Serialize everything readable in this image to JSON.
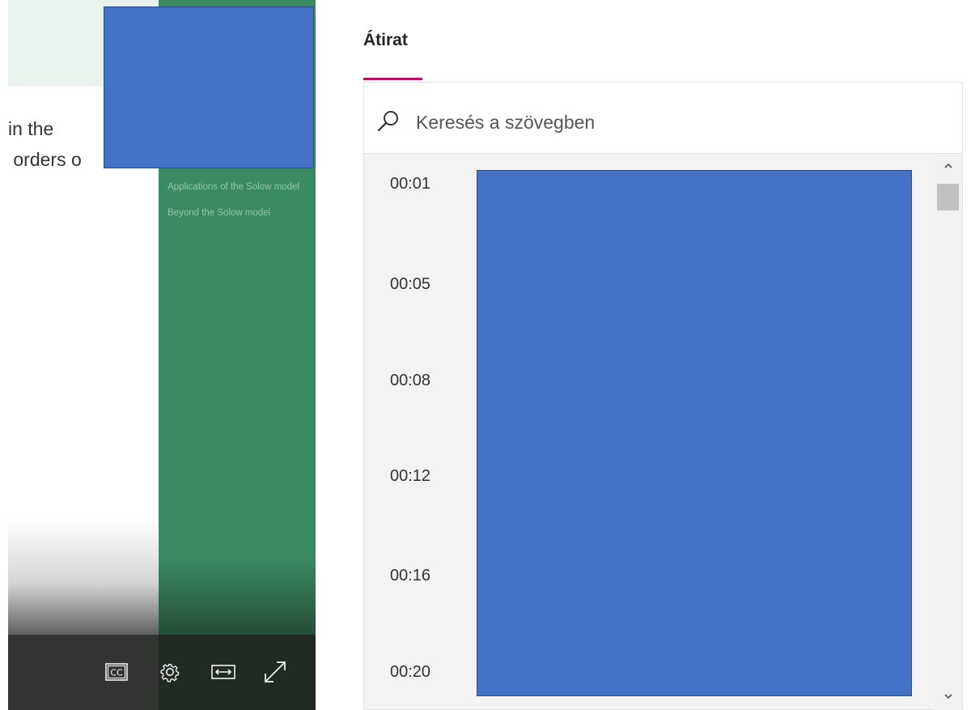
{
  "video": {
    "slide_text_line1": "in the",
    "slide_text_line2": " orders o",
    "slide_nav": [
      "Applications of the Solow model",
      "Beyond the Solow model"
    ],
    "controls": {
      "captions_icon": "cc-icon",
      "settings_icon": "gear-icon",
      "width_icon": "fit-width-icon",
      "fullscreen_icon": "expand-icon"
    }
  },
  "transcript": {
    "title": "Átirat",
    "accent_color": "#b4125e",
    "search_placeholder": "Keresés a szövegben",
    "timestamps": [
      "00:01",
      "00:05",
      "00:08",
      "00:12",
      "00:16",
      "00:20"
    ]
  },
  "colors": {
    "redaction": "#4472c4",
    "slide_green": "#3a8a64"
  }
}
